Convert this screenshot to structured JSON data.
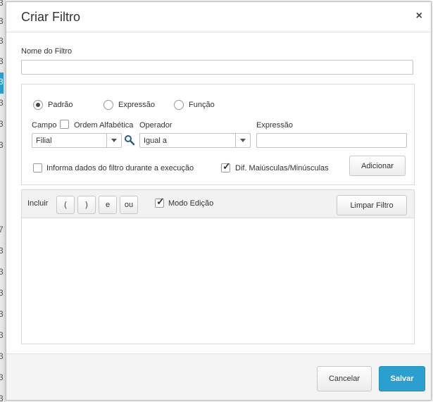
{
  "background": {
    "row_digits": [
      "3",
      "3",
      "3",
      "3",
      "3",
      "3",
      "3",
      "3",
      "7",
      "3",
      "3",
      "3",
      "3",
      "3",
      "3",
      "3",
      "3"
    ]
  },
  "dialog": {
    "title": "Criar Filtro",
    "close_glyph": "×"
  },
  "filter_name": {
    "label": "Nome do Filtro",
    "value": ""
  },
  "mode": {
    "options": [
      "Padrão",
      "Expressão",
      "Função"
    ],
    "selected": "Padrão"
  },
  "campo": {
    "label": "Campo",
    "ordem_label": "Ordem Alfabética",
    "ordem_checked": false,
    "value": "Filial",
    "search_icon": "search-icon"
  },
  "operador": {
    "label": "Operador",
    "value": "Igual a"
  },
  "expressao": {
    "label": "Expressão",
    "value": ""
  },
  "options": {
    "informa_label": "Informa dados do filtro durante a execução",
    "informa_checked": false,
    "dif_label": "Dif. Maiúsculas/Minúsculas",
    "dif_checked": true
  },
  "buttons": {
    "adicionar": "Adicionar",
    "limpar": "Limpar Filtro",
    "cancelar": "Cancelar",
    "salvar": "Salvar"
  },
  "toolbar": {
    "incluir_label": "Incluir",
    "ops": [
      "(",
      ")",
      "e",
      "ou"
    ],
    "modo_edicao_label": "Modo Edição",
    "modo_edicao_checked": true
  },
  "colors": {
    "accent": "#2b9fd0"
  }
}
